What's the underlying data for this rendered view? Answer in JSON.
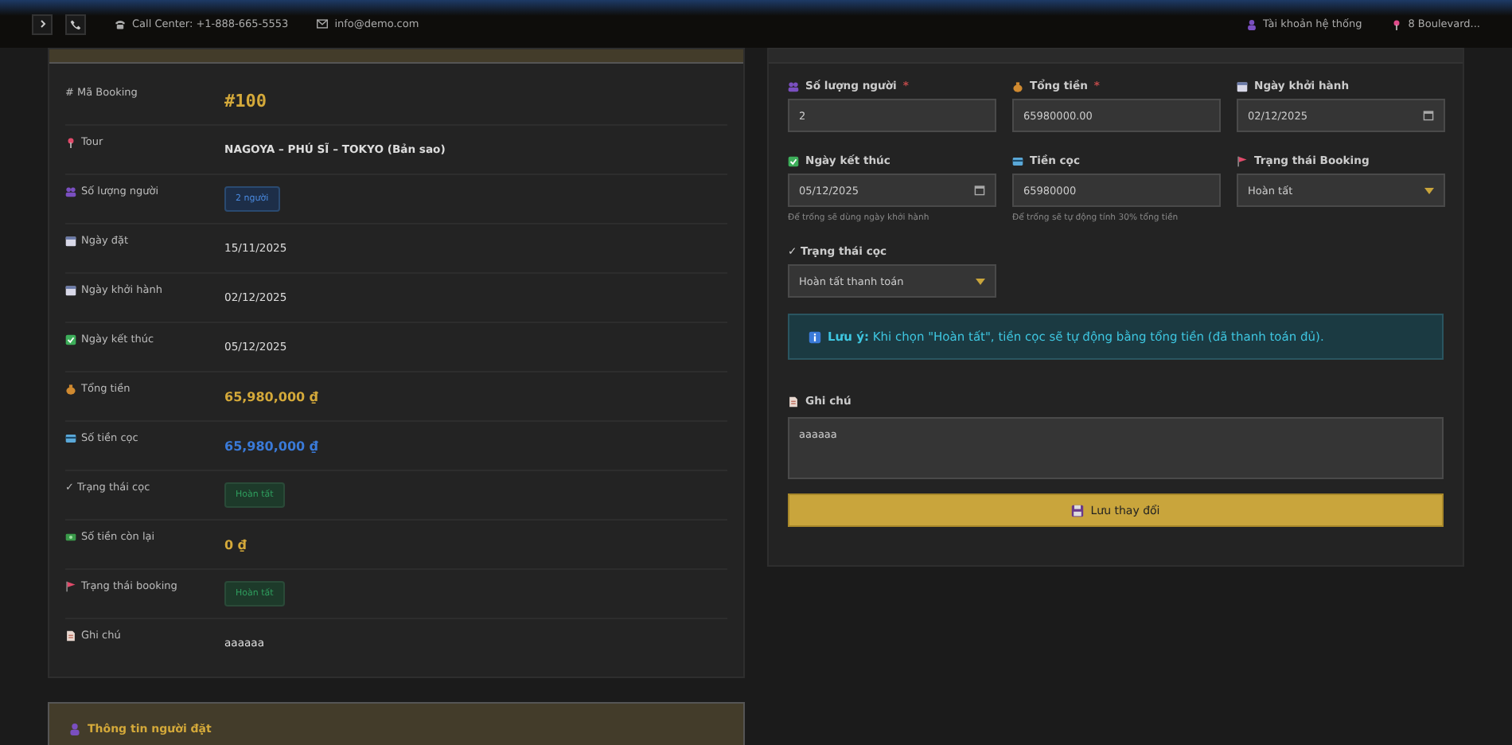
{
  "topbar": {
    "call_center": "Call Center: +1-888-665-5553",
    "email": "info@demo.com",
    "account": "Tài khoản hệ thống",
    "address": "8 Boulevard..."
  },
  "details": {
    "rows": [
      {
        "label": "# Mã Booking",
        "kind": "code",
        "value": "#100"
      },
      {
        "label": "Tour",
        "kind": "bold",
        "value": "NAGOYA – PHÚ SĨ – TOKYO (Bản sao)"
      },
      {
        "label": "Số lượng người",
        "kind": "pill",
        "value": "2 người"
      },
      {
        "label": "Ngày đặt",
        "kind": "text",
        "value": "15/11/2025"
      },
      {
        "label": "Ngày khởi hành",
        "kind": "text",
        "value": "02/12/2025"
      },
      {
        "label": "Ngày kết thúc",
        "kind": "text",
        "value": "05/12/2025"
      },
      {
        "label": "Tổng tiền",
        "kind": "money",
        "value": "65,980,000 ₫"
      },
      {
        "label": "Số tiền cọc",
        "kind": "money_blue",
        "value": "65,980,000 ₫"
      },
      {
        "label": "✓ Trạng thái cọc",
        "kind": "status",
        "value": "Hoàn tất"
      },
      {
        "label": "Số tiền còn lại",
        "kind": "money",
        "value": "0 ₫"
      },
      {
        "label": "Trạng thái booking",
        "kind": "status",
        "value": "Hoàn tất"
      },
      {
        "label": "Ghi chú",
        "kind": "text",
        "value": "aaaaaa"
      }
    ]
  },
  "form": {
    "fields": [
      {
        "label": "Số lượng người",
        "required_mark": "*",
        "kind": "number",
        "value": "2"
      },
      {
        "label": "Tổng tiền",
        "required_mark": "*",
        "kind": "number",
        "value": "65980000.00"
      },
      {
        "label": "Ngày khởi hành",
        "kind": "date",
        "value": "02/12/2025"
      },
      {
        "label": "Ngày kết thúc",
        "kind": "date",
        "value": "05/12/2025",
        "hint": "Để trống sẽ dùng ngày khởi hành"
      },
      {
        "label": "Tiền cọc",
        "kind": "number",
        "value": "65980000",
        "hint": "Để trống sẽ tự động tính 30% tổng tiền"
      },
      {
        "label": "Trạng thái Booking",
        "kind": "select",
        "value": "Hoàn tất"
      },
      {
        "label": "✓ Trạng thái cọc",
        "kind": "select",
        "value": "Hoàn tất thanh toán"
      }
    ],
    "notice": "**Lưu ý:** Khi chọn \"Hoàn tất\", tiền cọc sẽ tự động bằng tổng tiền (đã thanh toán đủ).",
    "note_label": "Ghi chú",
    "note_value": "aaaaaa",
    "save_button": "Lưu thay đổi"
  },
  "booker_card": {
    "title": "Thông tin người đặt"
  }
}
